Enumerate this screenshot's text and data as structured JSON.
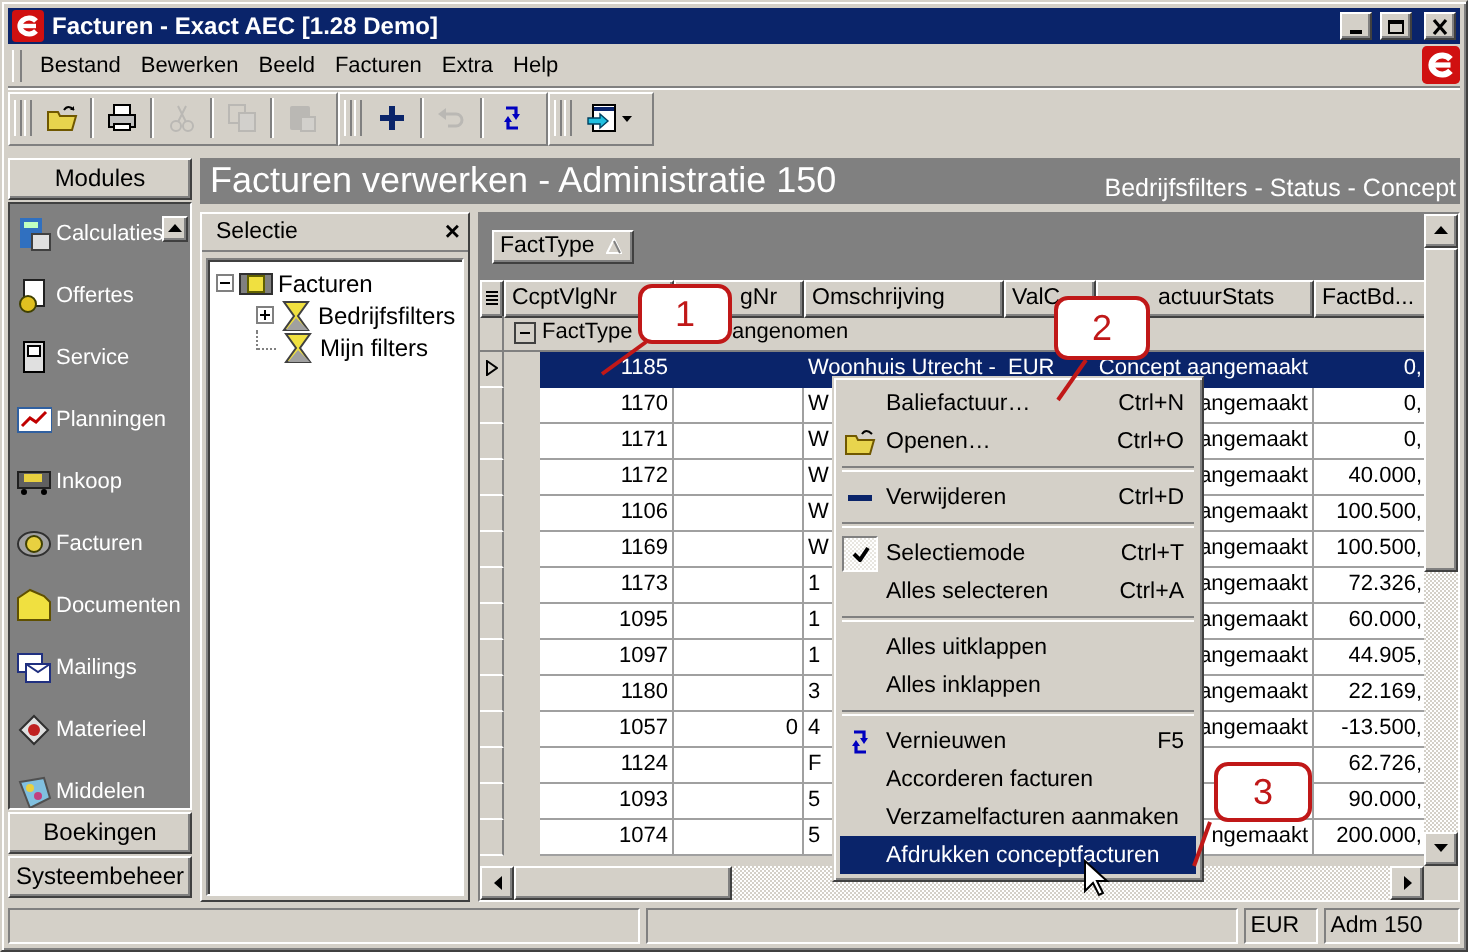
{
  "window": {
    "title": "Facturen - Exact AEC [1.28 Demo]"
  },
  "menu_bar": [
    "Bestand",
    "Bewerken",
    "Beeld",
    "Facturen",
    "Extra",
    "Help"
  ],
  "toolbars": [
    [
      {
        "kind": "open",
        "disabled": false
      },
      {
        "kind": "print",
        "disabled": false
      },
      {
        "kind": "cut",
        "disabled": true
      },
      {
        "kind": "copy",
        "disabled": true
      },
      {
        "kind": "paste",
        "disabled": true
      }
    ],
    [
      {
        "kind": "add",
        "disabled": false
      },
      {
        "kind": "undo",
        "disabled": true
      },
      {
        "kind": "refresh",
        "disabled": false
      }
    ],
    [
      {
        "kind": "export",
        "disabled": false
      }
    ]
  ],
  "sidebar": {
    "title": "Modules",
    "items": [
      {
        "label": "Calculaties"
      },
      {
        "label": "Offertes"
      },
      {
        "label": "Service"
      },
      {
        "label": "Planningen"
      },
      {
        "label": "Inkoop"
      },
      {
        "label": "Facturen"
      },
      {
        "label": "Documenten"
      },
      {
        "label": "Mailings"
      },
      {
        "label": "Materieel"
      },
      {
        "label": "Middelen"
      }
    ],
    "bottom_buttons": [
      "Boekingen",
      "Systeembeheer"
    ]
  },
  "header": {
    "title": "Facturen verwerken - Administratie 150",
    "breadcrumb": "Bedrijfsfilters - Status - Concept"
  },
  "selection_panel": {
    "title": "Selectie",
    "close": "×",
    "tree": [
      {
        "label": "Facturen",
        "expanded": true,
        "children": [
          {
            "label": "Bedrijfsfilters",
            "expanded": false
          },
          {
            "label": "Mijn filters"
          }
        ]
      }
    ]
  },
  "grid": {
    "group_by": "FactType",
    "columns": [
      "CcptVlgNr",
      "gNr",
      "Omschrijving",
      "ValC",
      "actuurStats",
      "FactBd..."
    ],
    "group_row": {
      "label": "FactType",
      "value": "angenomen",
      "expanded": true
    },
    "rows": [
      {
        "cells": [
          "1185",
          "",
          "Woonhuis Utrecht -",
          "EUR",
          "Concept aangemaakt",
          "0,"
        ],
        "selected": true
      },
      {
        "cells": [
          "1170",
          "",
          "W",
          "",
          "angemaakt",
          "0,"
        ],
        "selected": false
      },
      {
        "cells": [
          "1171",
          "",
          "W",
          "",
          "angemaakt",
          "0,"
        ],
        "selected": false
      },
      {
        "cells": [
          "1172",
          "",
          "W",
          "",
          "angemaakt",
          "40.000,"
        ],
        "selected": false
      },
      {
        "cells": [
          "1106",
          "",
          "W",
          "",
          "angemaakt",
          "100.500,"
        ],
        "selected": false
      },
      {
        "cells": [
          "1169",
          "",
          "W",
          "",
          "angemaakt",
          "100.500,"
        ],
        "selected": false
      },
      {
        "cells": [
          "1173",
          "",
          "1",
          "",
          "angemaakt",
          "72.326,"
        ],
        "selected": false
      },
      {
        "cells": [
          "1095",
          "",
          "1",
          "",
          "angemaakt",
          "60.000,"
        ],
        "selected": false
      },
      {
        "cells": [
          "1097",
          "",
          "1",
          "",
          "angemaakt",
          "44.905,"
        ],
        "selected": false
      },
      {
        "cells": [
          "1180",
          "",
          "3",
          "",
          "angemaakt",
          "22.169,"
        ],
        "selected": false
      },
      {
        "cells": [
          "1057",
          "0",
          "4",
          "",
          "angemaakt",
          "-13.500,"
        ],
        "selected": false
      },
      {
        "cells": [
          "1124",
          "",
          "F",
          "",
          "",
          "62.726,"
        ],
        "selected": false
      },
      {
        "cells": [
          "1093",
          "",
          "5",
          "",
          "",
          "90.000,"
        ],
        "selected": false
      },
      {
        "cells": [
          "1074",
          "",
          "5",
          "",
          "ngemaakt",
          "200.000,"
        ],
        "selected": false
      }
    ]
  },
  "context_menu": [
    {
      "kind": "item",
      "label": "Baliefactuur…",
      "shortcut": "Ctrl+N",
      "checked": false,
      "selected": false
    },
    {
      "kind": "item",
      "label": "Openen…",
      "shortcut": "Ctrl+O",
      "checked": false,
      "selected": false
    },
    {
      "kind": "separator"
    },
    {
      "kind": "item",
      "label": "Verwijderen",
      "shortcut": "Ctrl+D",
      "checked": false,
      "selected": false
    },
    {
      "kind": "separator"
    },
    {
      "kind": "item",
      "label": "Selectiemode",
      "shortcut": "Ctrl+T",
      "checked": true,
      "selected": false
    },
    {
      "kind": "item",
      "label": "Alles selecteren",
      "shortcut": "Ctrl+A",
      "checked": false,
      "selected": false
    },
    {
      "kind": "separator"
    },
    {
      "kind": "item",
      "label": "Alles uitklappen",
      "checked": false,
      "selected": false
    },
    {
      "kind": "item",
      "label": "Alles inklappen",
      "checked": false,
      "selected": false
    },
    {
      "kind": "separator"
    },
    {
      "kind": "item",
      "label": "Vernieuwen",
      "shortcut": "F5",
      "checked": false,
      "selected": false
    },
    {
      "kind": "item",
      "label": "Accorderen facturen",
      "checked": false,
      "selected": false
    },
    {
      "kind": "item",
      "label": "Verzamelfacturen aanmaken",
      "checked": false,
      "selected": false
    },
    {
      "kind": "item",
      "label": "Afdrukken conceptfacturen",
      "checked": false,
      "selected": true
    }
  ],
  "callouts": [
    "1",
    "2",
    "3"
  ],
  "status_bar": [
    "EUR",
    "Adm 150"
  ]
}
